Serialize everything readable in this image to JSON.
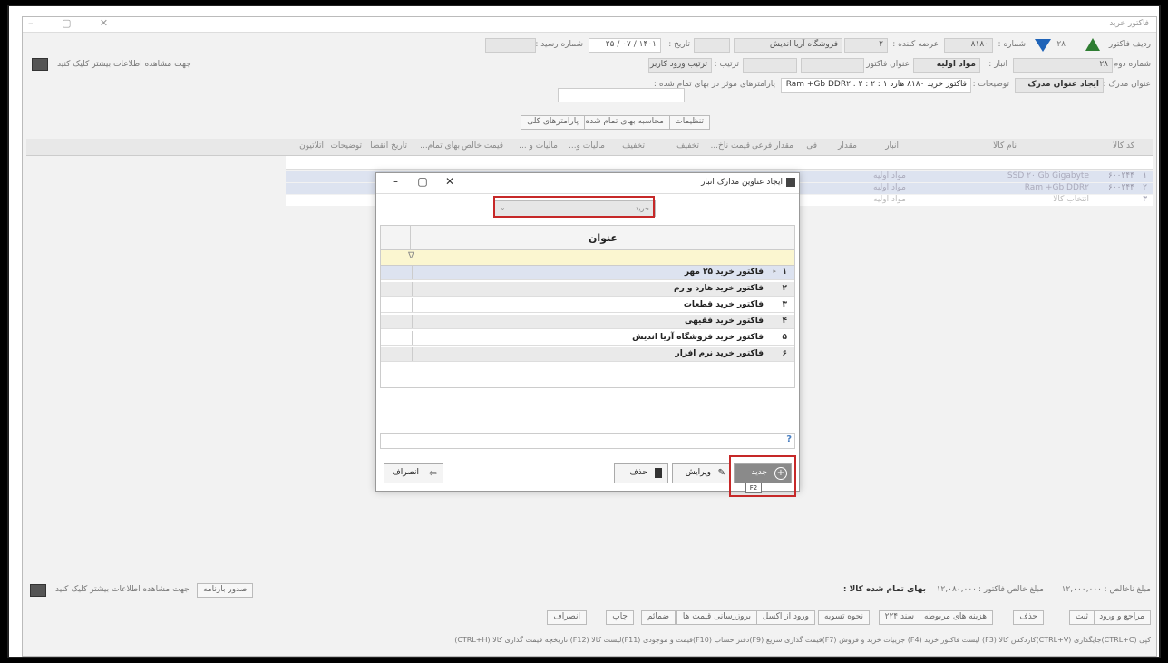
{
  "window": {
    "title": "فاکتور خرید"
  },
  "header": {
    "row1": {
      "invoice_row_label": "ردیف فاکتور :",
      "number_label": "شماره :",
      "number_value": "۸۱۸۰",
      "arrow_value": "۲۸",
      "supplier_label": "عرضه کننده :",
      "supplier_code": "۲",
      "supplier_name": "فروشگاه آریا اندیش",
      "date_label": "تاریخ :",
      "date_value": "۱۴۰۱ / ۰۷ / ۲۵",
      "receipt_label": "شماره رسید :"
    },
    "row2": {
      "second_number_label": "شماره دوم :",
      "second_number_value": "۲۸",
      "warehouse_label": "انبار :",
      "warehouse_value": "مواد اولیه",
      "invoice_title_label": "عنوان فاکتور :",
      "order_label": "ترتیب :",
      "order_value": "ترتیب ورود کاربر",
      "info_hint": "جهت مشاهده اطلاعات بیشتر کلیک کنید"
    },
    "row3": {
      "doc_title_label": "عنوان مدرک :",
      "create_doc_title_button": "ایجاد عنوان مدرک",
      "description_label": "توضیحات :",
      "description_value": "فاکتور خرید ۸۱۸۰ هارد ۱ : Ram +Gb DDR۲ . ۲ : ۲",
      "params_label": "پارامترهای موثر در بهای تمام شده :"
    },
    "row4": {
      "settings_button": "تنظیمات",
      "calc_cost_button": "محاسبه بهای تمام شده",
      "general_params_button": "پارامترهای کلی"
    }
  },
  "grid": {
    "columns": [
      "کد کالا",
      "نام کالا",
      "انبار",
      "مقدار",
      "فی",
      "مقدار فرعی",
      "قیمت ناخ...",
      "تخفیف",
      "تخفیف",
      "مالیات و...",
      "مالیات و ...",
      "قیمت خالص",
      "بهای تمام...",
      "تاریخ انقضا",
      "توضیحات",
      "اتلاتیون"
    ],
    "rows": [
      {
        "num": "۱",
        "code": "۶۰۰۲۴۴",
        "name": "SSD ۲۰ Gb Gigabyte",
        "warehouse": "مواد اولیه"
      },
      {
        "num": "۲",
        "code": "۶۰۰۲۴۴",
        "name": "Ram +Gb DDR۲",
        "warehouse": "مواد اولیه"
      },
      {
        "num": "۳",
        "code": "",
        "name": "انتخاب کالا",
        "warehouse": "مواد اولیه"
      }
    ]
  },
  "dialog": {
    "title": "ایجاد عناوین مدارک انبار",
    "combo_value": "خرید",
    "column_title": "عنوان",
    "filter_glyph": "∇",
    "rows": [
      {
        "num": "۱",
        "title": "فاکتور خرید ۲۵ مهر"
      },
      {
        "num": "۲",
        "title": "فاکتور خرید هارد و رم"
      },
      {
        "num": "۳",
        "title": "فاکتور خرید قطعات"
      },
      {
        "num": "۴",
        "title": "فاکتور خرید فقیهی"
      },
      {
        "num": "۵",
        "title": "فاکتور خرید فروشگاه آریا اندیش"
      },
      {
        "num": "۶",
        "title": "فاکتور خرید نرم افزار"
      }
    ],
    "search_glyph": "?",
    "buttons": {
      "new": "جدید",
      "edit": "ویرایش",
      "delete": "حذف",
      "cancel": "انصراف"
    },
    "new_shortcut": "F2"
  },
  "footer": {
    "shortage_label": "مبلغ ناخالص :",
    "shortage_value": "۱۲,۰۰۰,۰۰۰",
    "net_label": "مبلغ خالص فاکتور :",
    "net_value": "۱۲,۰۸۰,۰۰۰",
    "cost_label": "بهای تمام شده کالا :",
    "info_hint": "جهت مشاهده اطلاعات بیشتر کلیک کنید",
    "issue_button": "صدور بارنامه",
    "buttons": [
      "ثبت",
      "حذف",
      "هزینه های مربوطه",
      "سند ۲۲۴",
      "نحوه تسویه",
      "ورود از اکسل",
      "بروزرسانی قیمت ها",
      "ضمائم",
      "چاپ",
      "انصراف"
    ],
    "new_from_button": "مراجع و ورود",
    "shortcuts": "کپی (CTRL+C)جایگذاری (CTRL+V)کاردکس کالا (F3) لیست فاکتور خرید (F4) جزییات خرید و فروش (F7)قیمت گذاری سریع (F9)دفتر حساب (F10)قیمت و موجودی (F11)لیست کالا (F12) تاریخچه قیمت گذاری کالا (CTRL+H)"
  },
  "colors": {
    "accent_green": "#2e7d32",
    "accent_blue": "#1e63b8",
    "highlight_red": "#c62828",
    "row_selected": "#cfd8ea"
  }
}
